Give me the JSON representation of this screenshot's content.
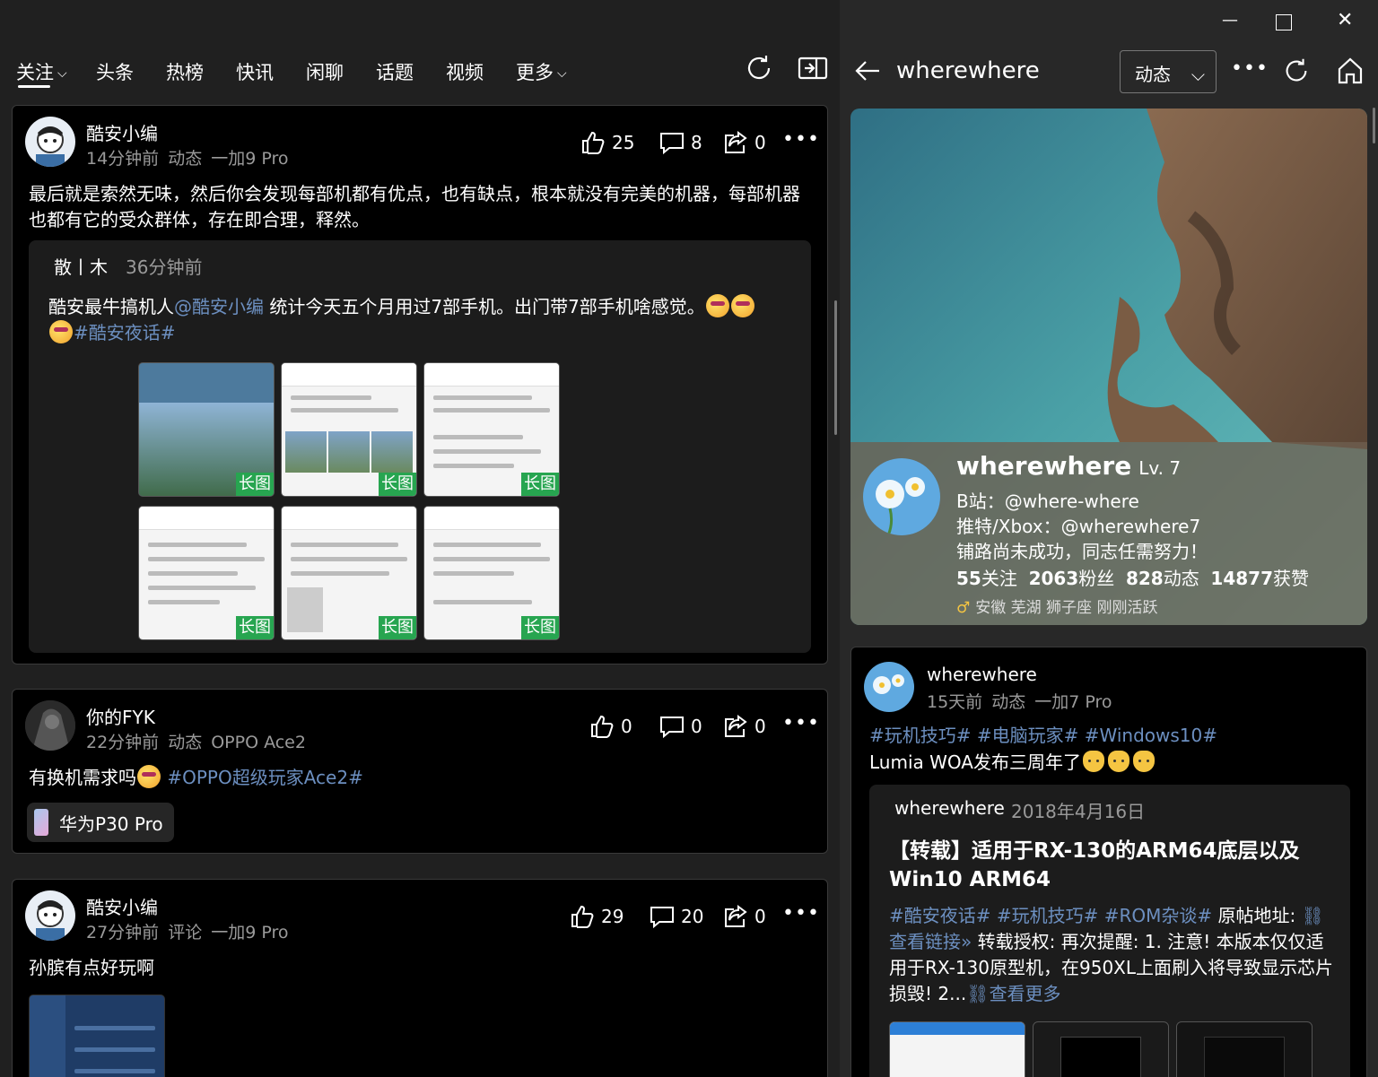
{
  "nav": {
    "tabs": [
      "关注",
      "头条",
      "热榜",
      "快讯",
      "闲聊",
      "话题",
      "视频",
      "更多"
    ],
    "active_tab": "关注"
  },
  "feed": [
    {
      "user": "酷安小编",
      "time": "14分钟前",
      "type": "动态",
      "device": "一加9 Pro",
      "likes": "25",
      "comments": "8",
      "shares": "0",
      "text": "最后就是索然无味，然后你会发现每部机都有优点，也有缺点，根本就没有完美的机器，每部机器也都有它的受众群体，存在即合理，释然。",
      "quote": {
        "user": "散丨木",
        "time": "36分钟前",
        "text_before": "酷安最牛搞机人",
        "mention": "@酷安小编",
        "text_after": " 统计今天五个月用过7部手机。出门带7部手机啥感觉。",
        "topic": "#酷安夜话#",
        "badge": "长图"
      }
    },
    {
      "user": "你的FYK",
      "time": "22分钟前",
      "type": "动态",
      "device": "OPPO Ace2",
      "likes": "0",
      "comments": "0",
      "shares": "0",
      "text": "有换机需求吗",
      "topic": "#OPPO超级玩家Ace2#",
      "product": "华为P30 Pro"
    },
    {
      "user": "酷安小编",
      "time": "27分钟前",
      "type": "评论",
      "device": "一加9 Pro",
      "likes": "29",
      "comments": "20",
      "shares": "0",
      "text": "孙膑有点好玩啊"
    }
  ],
  "profile_header": {
    "title": "wherewhere",
    "filter": "动态"
  },
  "profile": {
    "name": "wherewhere",
    "level": "Lv. 7",
    "bilibili": "B站：@where-where",
    "twitter": "推特/Xbox：@wherewhere7",
    "bio": "铺路尚未成功，同志任需努力！",
    "following": "55",
    "following_label": "关注",
    "fans": "2063",
    "fans_label": "粉丝",
    "posts": "828",
    "posts_label": "动态",
    "likes": "14877",
    "likes_label": "获赞",
    "location": "安徽 芜湖 狮子座 刚刚活跃"
  },
  "profile_post": {
    "user": "wherewhere",
    "time": "15天前",
    "type": "动态",
    "device": "一加7 Pro",
    "topics": "#玩机技巧# #电脑玩家# #Windows10#",
    "text": "Lumia WOA发布三周年了",
    "quote": {
      "user": "wherewhere",
      "date": "2018年4月16日",
      "title": "【转载】适用于RX-130的ARM64底层以及Win10 ARM64",
      "topics": "#酷安夜话# #玩机技巧# #ROM杂谈#",
      "text_a": " 原帖地址: ",
      "link": "查看链接»",
      "text_b": " 转载授权: 再次提醒: 1. 注意! 本版本仅仅适用于RX-130原型机，在950XL上面刷入将导致显示芯片损毁!  2...",
      "more": "查看更多"
    }
  },
  "colors": {
    "link": "#6c8fc0",
    "long_image_badge": "#27a550",
    "background": "#202020",
    "card": "#000000"
  }
}
